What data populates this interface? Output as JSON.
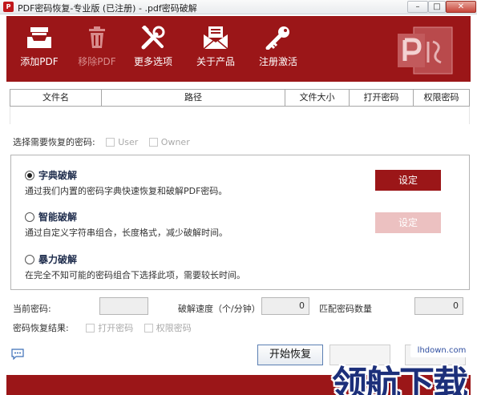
{
  "window": {
    "title": "PDF密码恢复-专业版 (已注册) - .pdf密码破解",
    "minimize": "–",
    "maximize": "□",
    "close": "✕"
  },
  "toolbar": {
    "add_pdf": "添加PDF",
    "remove_pdf": "移除PDF",
    "more_options": "更多选项",
    "about": "关于产品",
    "register": "注册激活"
  },
  "table": {
    "columns": [
      "文件名",
      "路径",
      "文件大小",
      "打开密码",
      "权限密码"
    ]
  },
  "recover_select": {
    "label": "选择需要恢复的密码:",
    "user": "User",
    "owner": "Owner"
  },
  "modes": {
    "dictionary": {
      "title": "字典破解",
      "desc": "通过我们内置的密码字典快速恢复和破解PDF密码。",
      "button": "设定",
      "selected": true
    },
    "smart": {
      "title": "智能破解",
      "desc": "通过自定义字符串组合，长度格式，减少破解时间。",
      "button": "设定",
      "selected": false
    },
    "brute": {
      "title": "暴力破解",
      "desc": "在完全不知可能的密码组合下选择此项，需要较长时间。",
      "selected": false
    }
  },
  "status": {
    "current_label": "当前密码:",
    "current_value": "",
    "speed_label": "破解速度（个/分钟）",
    "speed_value": "0",
    "match_label": "匹配密码数量",
    "match_value": "0"
  },
  "result": {
    "label": "密码恢复结果:",
    "open_pwd": "打开密码",
    "perm_pwd": "权限密码"
  },
  "actions": {
    "start": "开始恢复"
  },
  "watermark": {
    "text": "领航下载",
    "url": "lhdown.com"
  },
  "colors": {
    "brand": "#9b1618",
    "disabled": "#ecc1c1"
  }
}
